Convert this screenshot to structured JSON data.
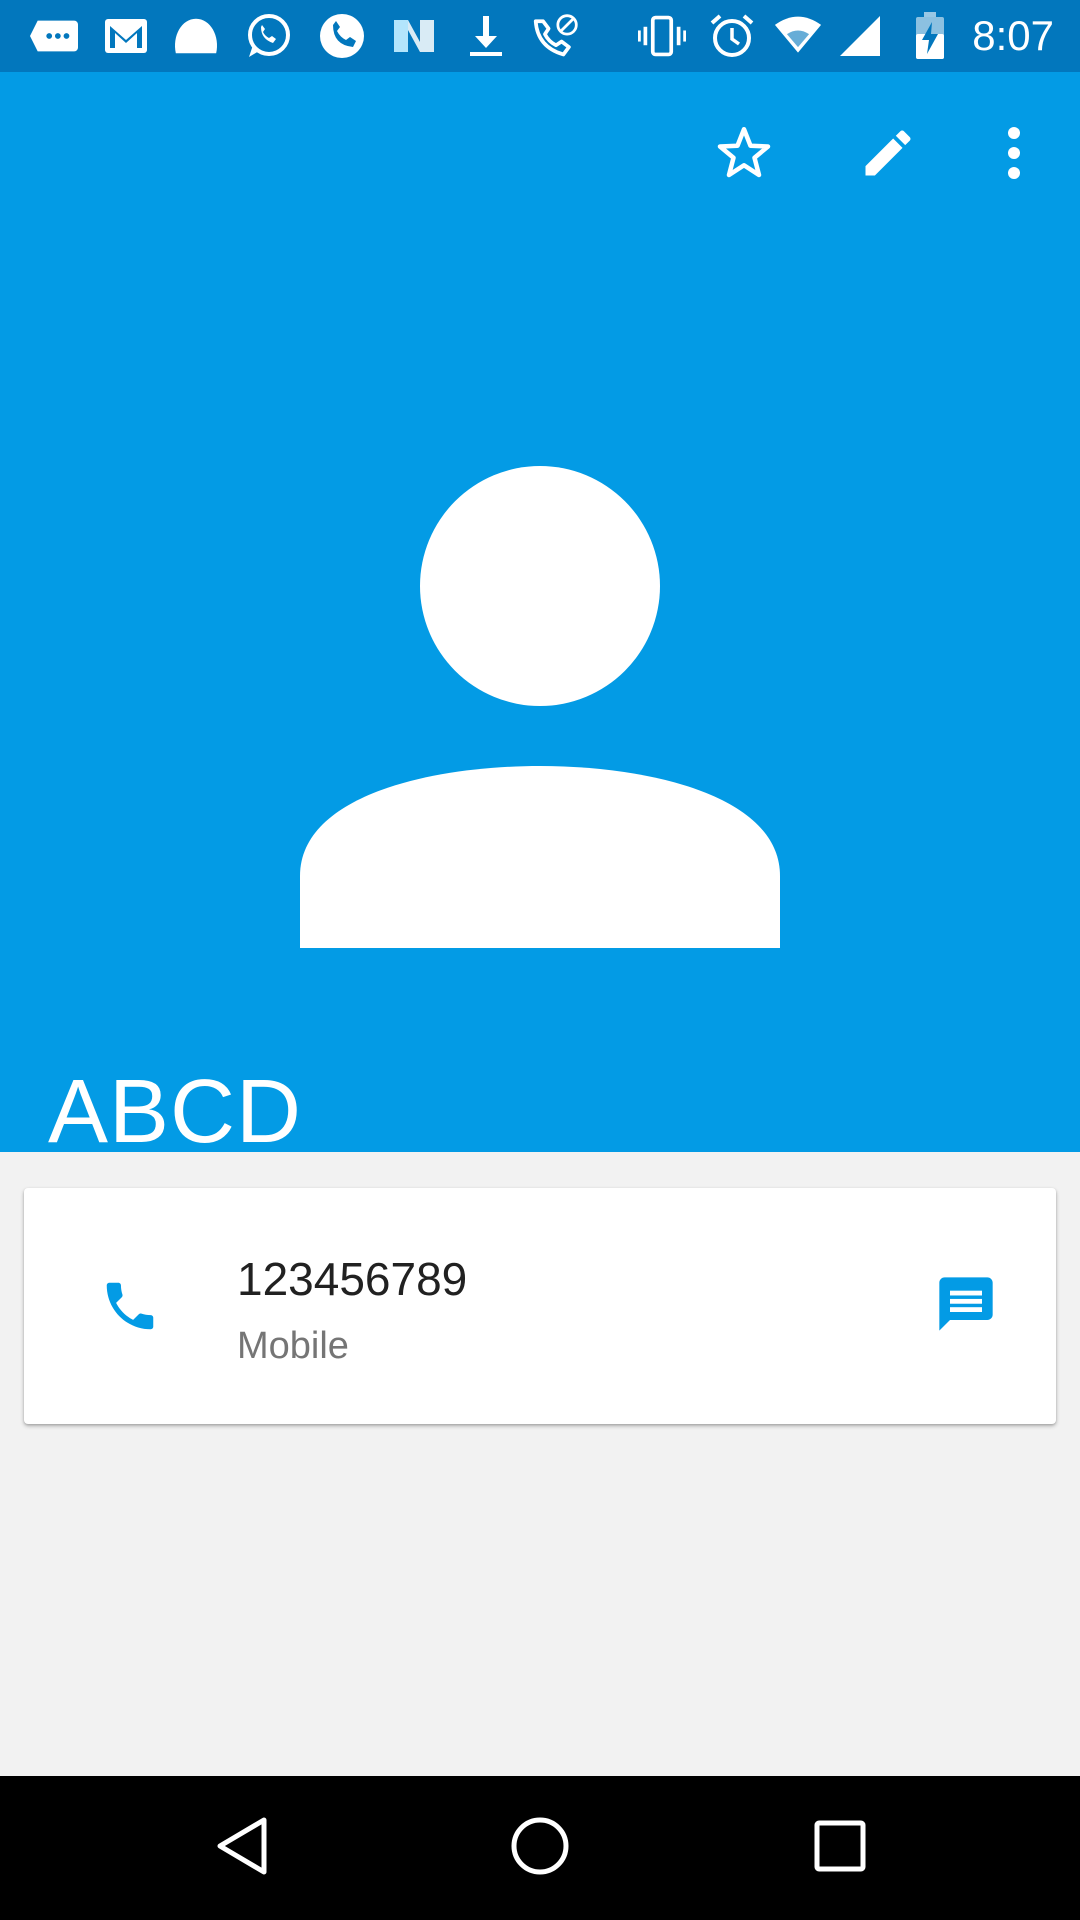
{
  "status_bar": {
    "time": "8:07",
    "icons": [
      "messages-icon",
      "gmail-icon",
      "hangouts-icon",
      "whatsapp-icon",
      "call-icon",
      "n-app-icon",
      "download-icon",
      "call-blocked-icon",
      "vibrate-icon",
      "alarm-icon",
      "wifi-icon",
      "signal-icon",
      "battery-charging-icon"
    ],
    "background": "#0277bd"
  },
  "header": {
    "background": "#039be5",
    "actions": [
      "star-icon",
      "edit-icon",
      "more-vert-icon"
    ],
    "contact_name": "ABCD"
  },
  "contact_card": {
    "phone_number": "123456789",
    "phone_type": "Mobile",
    "accent": "#039be5",
    "icons": [
      "phone-icon",
      "message-icon"
    ]
  },
  "nav_bar": {
    "buttons": [
      "back-icon",
      "home-icon",
      "recents-icon"
    ]
  }
}
